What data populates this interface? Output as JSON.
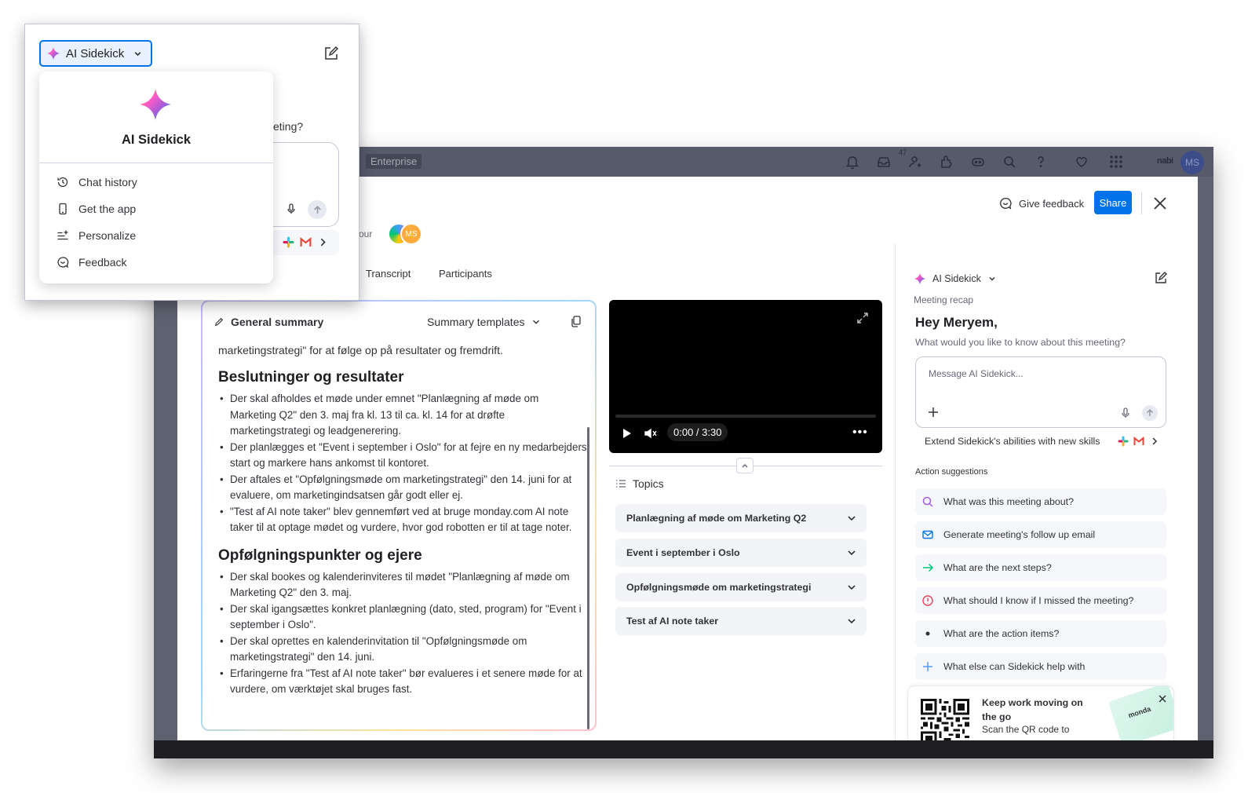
{
  "topbar": {
    "enterprise_badge": "Enterprise",
    "notifications_count": "47",
    "account_label": "nabi",
    "avatar_initials": "MS"
  },
  "header": {
    "give_feedback": "Give feedback",
    "share": "Share",
    "hour_text": "our",
    "participant_initials": "MS"
  },
  "tabs": [
    "Transcript",
    "Participants"
  ],
  "summary": {
    "title": "General summary",
    "templates_label": "Summary templates",
    "lead": "marketingstrategi\" for at følge op på resultater og fremdrift.",
    "sections": [
      {
        "heading": "Beslutninger og resultater",
        "items": [
          "Der skal afholdes et møde under emnet \"Planlægning af møde om Marketing Q2\" den 3. maj fra kl. 13 til ca. kl. 14 for at drøfte marketingstrategi og leadgenerering.",
          "Der planlægges et \"Event i september i Oslo\" for at fejre en ny medarbejders start og markere hans ankomst til kontoret.",
          "Der aftales et \"Opfølgningsmøde om marketingstrategi\" den 14. juni for at evaluere, om marketingindsatsen går godt eller ej.",
          "\"Test af AI note taker\" blev gennemført ved at bruge monday.com AI note taker til at optage mødet og vurdere, hvor god robotten er til at tage noter."
        ]
      },
      {
        "heading": "Opfølgningspunkter og ejere",
        "items": [
          "Der skal bookes og kalenderinviteres til mødet \"Planlægning af møde om Marketing Q2\" den 3. maj.",
          "Der skal igangsættes konkret planlægning (dato, sted, program) for \"Event i september i Oslo\".",
          "Der skal oprettes en kalenderinvitation til \"Opfølgningsmøde om marketingstrategi\" den 14. juni.",
          "Erfaringerne fra \"Test af AI note taker\" bør evalueres i et senere møde for at vurdere, om værktøjet skal bruges fast."
        ]
      }
    ]
  },
  "video": {
    "time": "0:00 / 3:30",
    "more": "•••"
  },
  "topics": {
    "title": "Topics",
    "items": [
      "Planlægning af møde om Marketing Q2",
      "Event i september i Oslo",
      "Opfølgningsmøde om marketingstrategi",
      "Test af AI note taker"
    ]
  },
  "sidekick": {
    "title": "AI Sidekick",
    "subtitle": "Meeting recap",
    "greeting": "Hey Meryem,",
    "question": "What would you like to know about this meeting?",
    "input_placeholder": "Message AI Sidekick...",
    "extend_text": "Extend Sidekick's abilities with new skills",
    "action_header": "Action suggestions",
    "suggestions": [
      {
        "label": "What was this meeting about?",
        "icon": "search-icon",
        "color": "#a25ddc"
      },
      {
        "label": "Generate meeting's follow up email",
        "icon": "mail-icon",
        "color": "#0073ea"
      },
      {
        "label": "What are the next steps?",
        "icon": "arrow-right-icon",
        "color": "#00c875"
      },
      {
        "label": "What should I know if I missed the meeting?",
        "icon": "alert-icon",
        "color": "#e2445c"
      },
      {
        "label": "What are the action items?",
        "icon": "dot-icon",
        "color": "#323338"
      },
      {
        "label": "What else can Sidekick help with",
        "icon": "plus-icon",
        "color": "#579bfc"
      }
    ],
    "promo": {
      "title": "Keep work moving on the go",
      "subtitle": "Scan the QR code to",
      "logo_text": "monda"
    }
  },
  "popup": {
    "selector_label": "AI Sidekick",
    "behind_text": "eting?",
    "menu": {
      "title": "AI Sidekick",
      "items": [
        {
          "label": "Chat history",
          "icon": "history-icon"
        },
        {
          "label": "Get the app",
          "icon": "phone-icon"
        },
        {
          "label": "Personalize",
          "icon": "sliders-icon"
        },
        {
          "label": "Feedback",
          "icon": "feedback-icon"
        }
      ]
    }
  },
  "colors": {
    "primary": "#0073ea",
    "panel_bg": "#ffffff",
    "topbar_bg": "#575a6a"
  }
}
